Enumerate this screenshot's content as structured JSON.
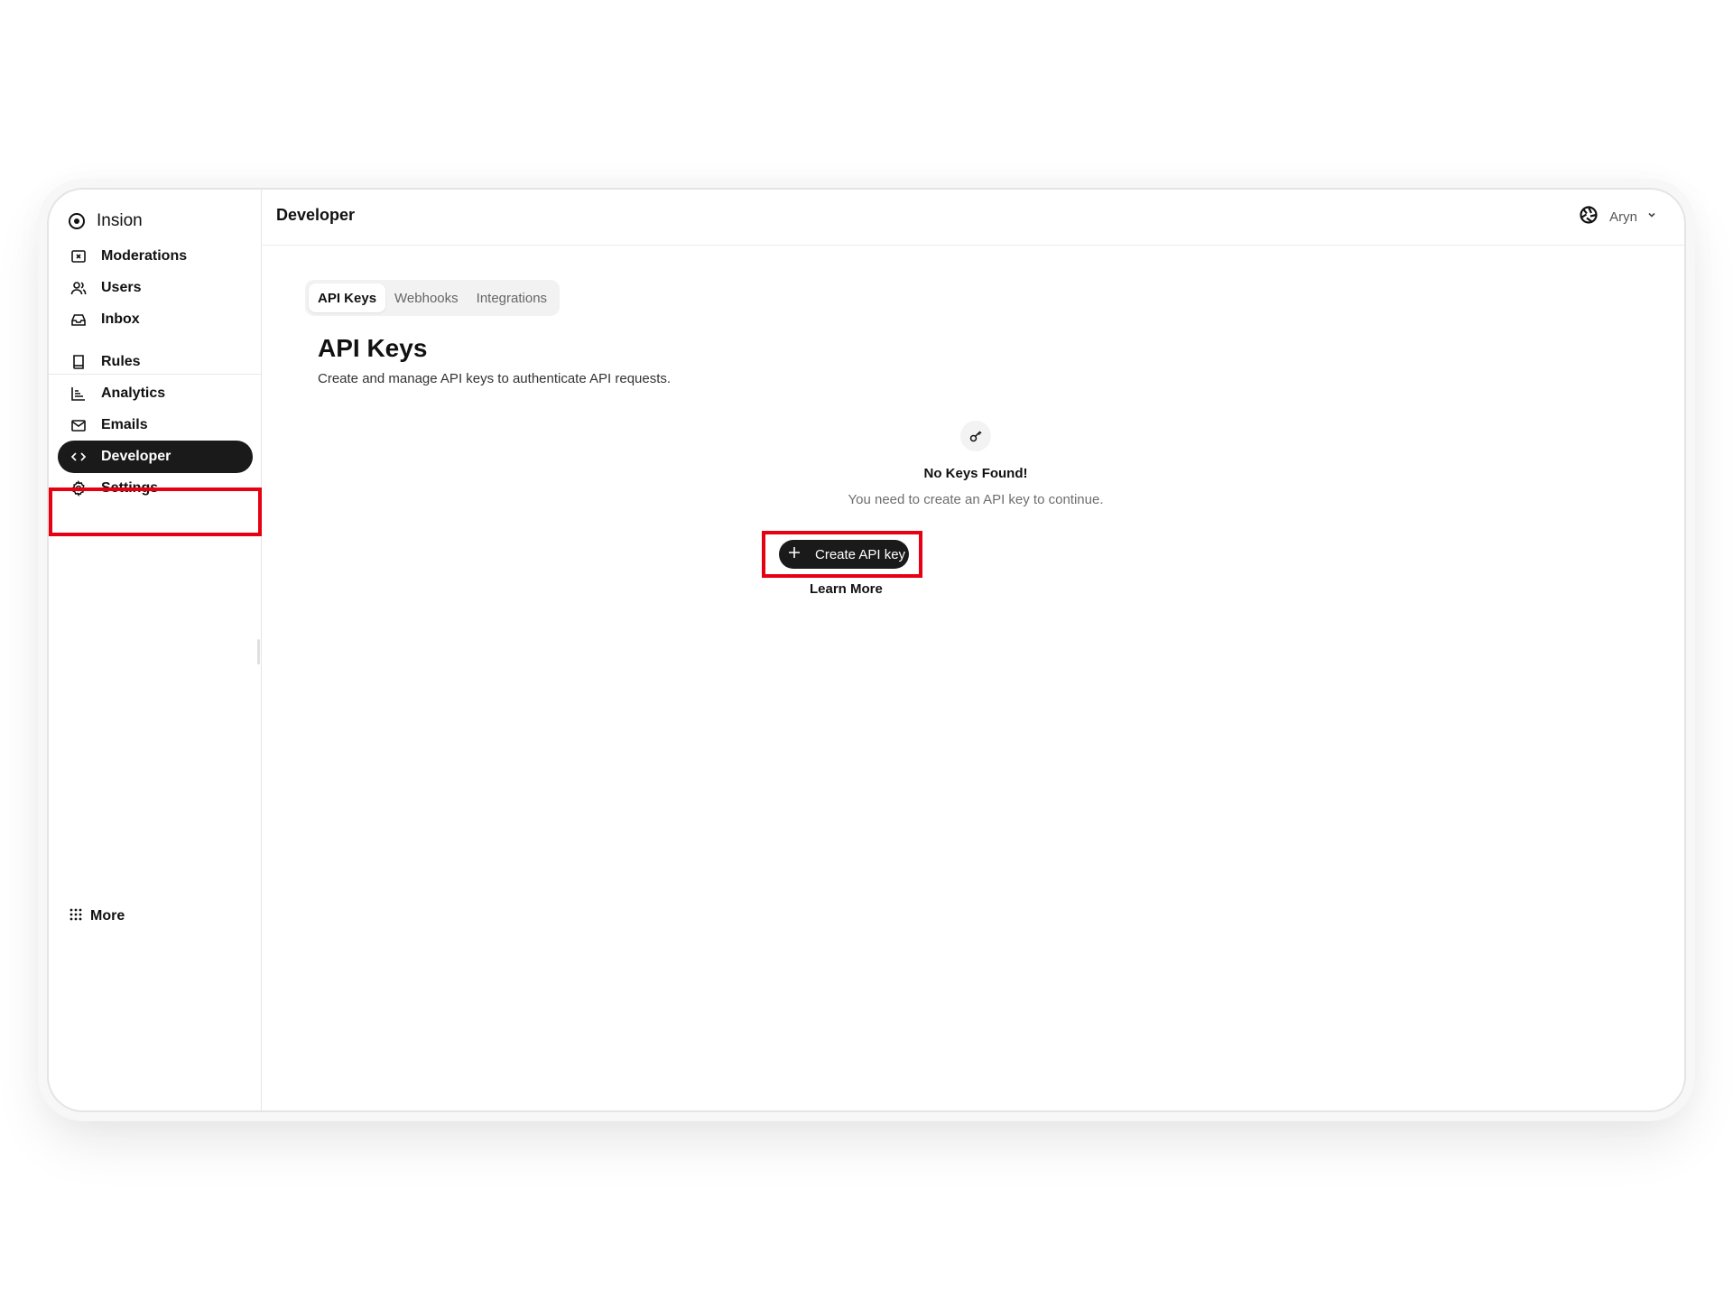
{
  "app": {
    "name": "Insion"
  },
  "sidebar": {
    "items": [
      {
        "label": "Moderations",
        "icon": "moderation-icon"
      },
      {
        "label": "Users",
        "icon": "users-icon"
      },
      {
        "label": "Inbox",
        "icon": "inbox-icon"
      },
      {
        "label": "Rules",
        "icon": "book-icon"
      },
      {
        "label": "Analytics",
        "icon": "chart-icon"
      },
      {
        "label": "Emails",
        "icon": "mail-icon"
      },
      {
        "label": "Developer",
        "icon": "code-icon",
        "active": true
      },
      {
        "label": "Settings",
        "icon": "gear-icon"
      }
    ],
    "more_label": "More"
  },
  "header": {
    "title": "Developer",
    "user_name": "Aryn"
  },
  "tabs": [
    {
      "label": "API Keys",
      "active": true
    },
    {
      "label": "Webhooks",
      "active": false
    },
    {
      "label": "Integrations",
      "active": false
    }
  ],
  "main": {
    "title": "API Keys",
    "description": "Create and manage API keys to authenticate API requests.",
    "empty_title": "No Keys Found!",
    "empty_subtitle": "You need to create an API key to continue.",
    "create_label": "Create API key",
    "learn_more_label": "Learn More"
  },
  "colors": {
    "active_bg": "#1a1a1a",
    "highlight": "#e60012"
  }
}
